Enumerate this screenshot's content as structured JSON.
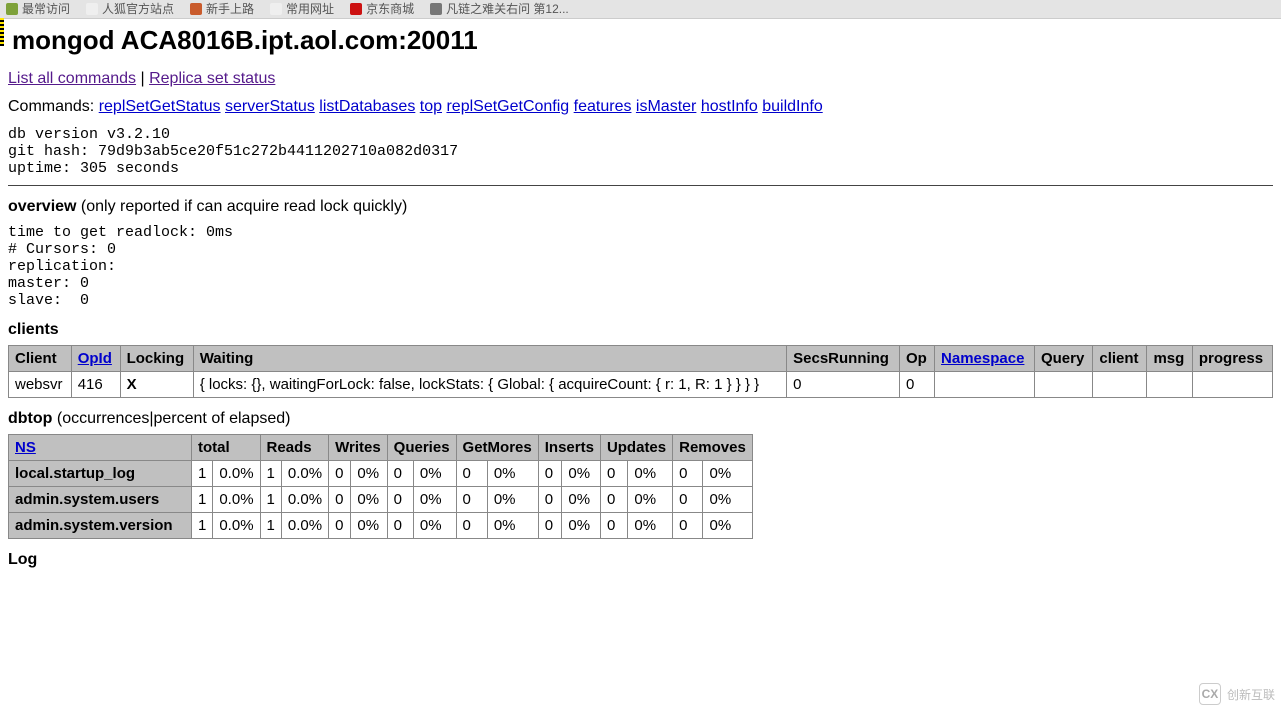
{
  "bookmarks": [
    {
      "icon": "#7ea13a",
      "label": "最常访问"
    },
    {
      "icon": "#efefef",
      "label": "人狐官方站点"
    },
    {
      "icon": "#c95b2c",
      "label": "新手上路"
    },
    {
      "icon": "#efefef",
      "label": "常用网址"
    },
    {
      "icon": "#c11",
      "label": "京东商城"
    },
    {
      "icon": "#777",
      "label": "凡链之难关右问 第12..."
    }
  ],
  "header": {
    "title": "mongod ACA8016B.ipt.aol.com:20011"
  },
  "nav": {
    "list_all": "List all commands",
    "sep": " | ",
    "replica": "Replica set status"
  },
  "commands": {
    "label": "Commands: ",
    "items": [
      "replSetGetStatus",
      "serverStatus",
      "listDatabases",
      "top",
      "replSetGetConfig",
      "features",
      "isMaster",
      "hostInfo",
      "buildInfo"
    ]
  },
  "preinfo": "db version v3.2.10\ngit hash: 79d9b3ab5ce20f51c272b4411202710a082d0317\nuptime: 305 seconds",
  "overview": {
    "label": "overview",
    "note": " (only reported if can acquire read lock quickly)",
    "body": "time to get readlock: 0ms\n# Cursors: 0\nreplication: \nmaster: 0\nslave:  0"
  },
  "clients": {
    "label": "clients",
    "headers": [
      "Client",
      "OpId",
      "Locking",
      "Waiting",
      "SecsRunning",
      "Op",
      "Namespace",
      "Query",
      "client",
      "msg",
      "progress"
    ],
    "header_links": {
      "OpId": true,
      "Namespace": true
    },
    "rows": [
      {
        "Client": "websvr",
        "OpId": "416",
        "Locking": "X",
        "Waiting": "{ locks: {}, waitingForLock: false, lockStats: { Global: { acquireCount: { r: 1, R: 1 } } } }",
        "SecsRunning": "0",
        "Op": "0",
        "Namespace": "",
        "Query": "",
        "client": "",
        "msg": "",
        "progress": ""
      }
    ]
  },
  "dbtop": {
    "label": "dbtop",
    "note": " (occurrences|percent of elapsed)",
    "ns_header": "NS",
    "cols": [
      "total",
      "Reads",
      "Writes",
      "Queries",
      "GetMores",
      "Inserts",
      "Updates",
      "Removes"
    ],
    "rows": [
      {
        "ns": "local.startup_log",
        "cells": [
          [
            "1",
            "0.0%"
          ],
          [
            "1",
            "0.0%"
          ],
          [
            "0",
            "0%"
          ],
          [
            "0",
            "0%"
          ],
          [
            "0",
            "0%"
          ],
          [
            "0",
            "0%"
          ],
          [
            "0",
            "0%"
          ],
          [
            "0",
            "0%"
          ]
        ]
      },
      {
        "ns": "admin.system.users",
        "cells": [
          [
            "1",
            "0.0%"
          ],
          [
            "1",
            "0.0%"
          ],
          [
            "0",
            "0%"
          ],
          [
            "0",
            "0%"
          ],
          [
            "0",
            "0%"
          ],
          [
            "0",
            "0%"
          ],
          [
            "0",
            "0%"
          ],
          [
            "0",
            "0%"
          ]
        ]
      },
      {
        "ns": "admin.system.version",
        "cells": [
          [
            "1",
            "0.0%"
          ],
          [
            "1",
            "0.0%"
          ],
          [
            "0",
            "0%"
          ],
          [
            "0",
            "0%"
          ],
          [
            "0",
            "0%"
          ],
          [
            "0",
            "0%"
          ],
          [
            "0",
            "0%"
          ],
          [
            "0",
            "0%"
          ]
        ]
      }
    ]
  },
  "log": {
    "label": "Log"
  },
  "watermark": {
    "logo": "CX",
    "text": "创新互联"
  }
}
